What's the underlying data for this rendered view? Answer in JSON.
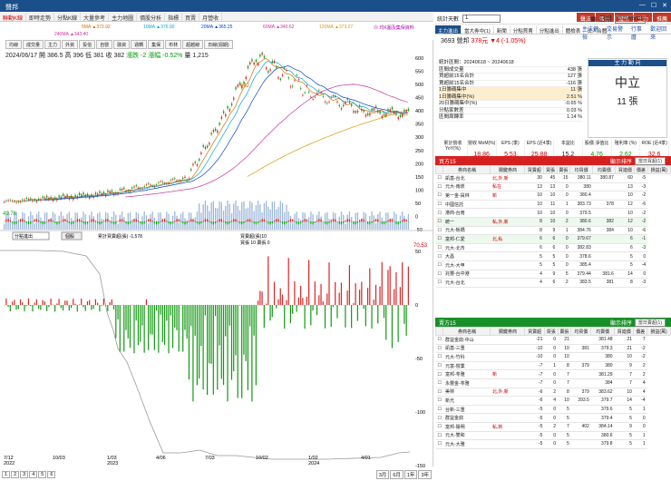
{
  "window": {
    "title": "聲邦",
    "controls": [
      "—",
      "☐",
      "✕"
    ]
  },
  "menubar": {
    "items": [
      "聯動K線",
      "即時走勢",
      "分點K線",
      "大量參考",
      "主力地圖",
      "價股分析",
      "指標",
      "買賣",
      "月營收"
    ],
    "active": 0
  },
  "top_buttons": [
    "聲法",
    "報表",
    "體熱",
    "主力",
    "推薦"
  ],
  "top_links": [
    "主法健檢",
    "交易警示",
    "行事曆",
    "歡迎回來"
  ],
  "ma_legend": [
    {
      "label": "5MA ▲373.92",
      "color": "#d07000"
    },
    {
      "label": "10MA ▲376.00",
      "color": "#00aadd"
    },
    {
      "label": "20MA ▲365.25",
      "color": "#0044cc"
    },
    {
      "label": "60MA ▲340.62",
      "color": "#cc3399"
    },
    {
      "label": "120MA ▲373.27",
      "color": "#dd9900"
    },
    {
      "label": "⓪ 均K圖及集保資料",
      "color": "#aa00aa"
    },
    {
      "label": "240MA ▲343.40",
      "color": "#cc3399"
    }
  ],
  "subtabs": [
    "均線",
    "成交量",
    "主力",
    "外資",
    "投信",
    "自營",
    "融資",
    "週轉",
    "集保",
    "布林",
    "超越線",
    "日線(週期)"
  ],
  "infoline": {
    "date": "2024/06/17",
    "open": "開 386.5",
    "high": "高 396",
    "low": "低 381",
    "close": "收 382",
    "change": "漲跌 -2",
    "pct": "漲幅 -0.52%",
    "volume": "量 1,215"
  },
  "price_axis": [
    "600",
    "550",
    "500",
    "450",
    "400",
    "350",
    "300",
    "250",
    "200",
    "150",
    "100",
    "50",
    "0",
    "-50"
  ],
  "price_labels": {
    "high": "642",
    "low": "49.76"
  },
  "lower_panel": {
    "selector": "分點進出",
    "button": "個股",
    "legend1": "累計買賣超(張) -1,578",
    "legend2": "買賣超(張)10",
    "legend3": "買張 10 賣張 0",
    "last_value": "70.53"
  },
  "lower_axis": [
    "50",
    "0",
    "-50",
    "-100",
    "-150"
  ],
  "x_axis": [
    "7/12\n2022",
    "10/03",
    "1/03\n2023",
    "4/06",
    "7/03",
    "10/02",
    "1/02\n2024",
    "4/01"
  ],
  "bottom": {
    "pages": [
      "1",
      "2",
      "3",
      "4",
      "5",
      "6"
    ],
    "periods": [
      "3月",
      "6月",
      "1年",
      "3年"
    ]
  },
  "right": {
    "selector_label": "統計天數",
    "selector_value": "1",
    "date_label": "日期",
    "date_value": "2024/6/18",
    "tabs": [
      "主力進出",
      "當大券中(1)",
      "新聞",
      "分點買賣",
      "分點進出",
      "體檢表",
      "法人合體"
    ],
    "stock": {
      "code_name": "3693 營邦",
      "price": "378元",
      "change": "▼4 (-1.05%)"
    },
    "summary": [
      {
        "k": "統計區間：20240618 ~ 20240618",
        "v": ""
      },
      {
        "k": "區間成交量",
        "v": "438 張"
      },
      {
        "k": "買超前15名合計",
        "v": "127 張"
      },
      {
        "k": "賣超前15名合計",
        "v": "-116 張"
      },
      {
        "k": "1日籌碼集中",
        "v": "11 張"
      },
      {
        "k": "1日籌碼集中(%)",
        "v": "2.51 %"
      },
      {
        "k": "20日籌碼集中(%)",
        "v": "-0.65 %"
      },
      {
        "k": "分點家數差",
        "v": "0.03 %"
      },
      {
        "k": "區間周轉率",
        "v": "1.14 %"
      }
    ],
    "mainforce": {
      "h1": "主 力 動 向",
      "label": "中立",
      "lots": "11 張"
    },
    "metrics": [
      {
        "k": "累計營收 YoY(%)",
        "v": "9.51",
        "c": "r"
      },
      {
        "k": "營收 MoM(%)",
        "v": "18.86",
        "c": "r"
      },
      {
        "k": "EPS (季)",
        "v": "5.53",
        "c": "r"
      },
      {
        "k": "EPS (近4季)",
        "v": "25.88",
        "c": "r"
      },
      {
        "k": "本益比",
        "v": "15.2",
        "c": "k"
      },
      {
        "k": "股價 淨值比",
        "v": "4.76",
        "c": "g"
      },
      {
        "k": "殖利率 (%)",
        "v": "2.62",
        "c": "g"
      },
      {
        "k": "ROE (近4季)",
        "v": "32.6",
        "c": "r"
      }
    ],
    "buy_header": {
      "title": "買方15",
      "sort": "顯示排序",
      "sort_value": "當日買超(1)"
    },
    "sell_header": {
      "title": "賣方15",
      "sort": "顯示排序",
      "sort_value": "當日賣超(1)"
    },
    "cols": [
      "券商名稱",
      "關鍵券商",
      "買賣超",
      "買張",
      "賣張",
      "均買價",
      "均賣價",
      "買進價",
      "價差",
      "損益(萬)"
    ],
    "buy_rows": [
      [
        "凱基-台北",
        "北,外,新",
        "30",
        "45",
        "15",
        "380.11",
        "380.87",
        "60",
        "-5"
      ],
      [
        "元大-南崁",
        "私在",
        "13",
        "13",
        "0",
        "380",
        "",
        "13",
        "-3"
      ],
      [
        "第一金-員林",
        "新",
        "10",
        "10",
        "0",
        "380.4",
        "",
        "10",
        "-2"
      ],
      [
        "中國信託",
        "",
        "10",
        "11",
        "1",
        "383.73",
        "378",
        "12",
        "-6"
      ],
      [
        "港商-台南",
        "",
        "10",
        "10",
        "0",
        "379.5",
        "",
        "10",
        "-2"
      ],
      [
        "統一",
        "私,外,新",
        "8",
        "10",
        "2",
        "380.6",
        "382",
        "12",
        "-2"
      ],
      [
        "元大-板橋",
        "",
        "8",
        "9",
        "1",
        "384.76",
        "384",
        "10",
        "-6"
      ],
      [
        "富邦-仁愛",
        "北,私",
        "6",
        "6",
        "0",
        "379.67",
        "",
        "6",
        "-1"
      ],
      [
        "元大-北市",
        "",
        "6",
        "6",
        "0",
        "382.83",
        "",
        "6",
        "-3"
      ],
      [
        "大昌",
        "",
        "5",
        "5",
        "0",
        "378.6",
        "",
        "5",
        "0"
      ],
      [
        "元大-大甲",
        "",
        "5",
        "5",
        "0",
        "385.4",
        "",
        "5",
        "-4"
      ],
      [
        "兆豐-台中港",
        "",
        "4",
        "9",
        "5",
        "379.44",
        "381.6",
        "14",
        "0"
      ],
      [
        "元大-台北",
        "",
        "4",
        "6",
        "2",
        "383.5",
        "381",
        "8",
        "-3"
      ]
    ],
    "sell_rows": [
      [
        "群益金鼎-中山",
        "",
        "-21",
        "0",
        "21",
        "",
        "381.48",
        "21",
        "7"
      ],
      [
        "凱基-三重",
        "",
        "-10",
        "0",
        "10",
        "381",
        "379.3",
        "21",
        "-2"
      ],
      [
        "元大-竹科",
        "",
        "-10",
        "0",
        "10",
        "",
        "380",
        "10",
        "-2"
      ],
      [
        "元富-營業",
        "",
        "-7",
        "1",
        "8",
        "379",
        "380",
        "9",
        "2"
      ],
      [
        "富邦-苓雅",
        "新",
        "-7",
        "0",
        "7",
        "",
        "381.29",
        "7",
        "2"
      ],
      [
        "永豐金-苓雅",
        "",
        "-7",
        "0",
        "7",
        "",
        "384",
        "7",
        "4"
      ],
      [
        "美林",
        "北,外,新",
        "-6",
        "2",
        "8",
        "379",
        "383.62",
        "10",
        "4"
      ],
      [
        "新光",
        "",
        "-6",
        "4",
        "10",
        "393.5",
        "379.7",
        "14",
        "-4"
      ],
      [
        "台新-三重",
        "",
        "-5",
        "0",
        "5",
        "",
        "379.6",
        "5",
        "1"
      ],
      [
        "群益金鼎",
        "",
        "-5",
        "0",
        "5",
        "",
        "379.4",
        "5",
        "0"
      ],
      [
        "富邦-陽明",
        "私,新",
        "-5",
        "2",
        "7",
        "402",
        "384.14",
        "9",
        "0"
      ],
      [
        "元大-雙和",
        "",
        "-5",
        "0",
        "5",
        "",
        "380.6",
        "5",
        "1"
      ],
      [
        "元大-大雅",
        "",
        "-5",
        "0",
        "5",
        "",
        "379.8",
        "5",
        "1"
      ]
    ]
  },
  "colors": {
    "up": "#dd2222",
    "down": "#119911",
    "accent": "#1b4f8a",
    "buy_header": "#d62020",
    "sell_header": "#189028"
  }
}
